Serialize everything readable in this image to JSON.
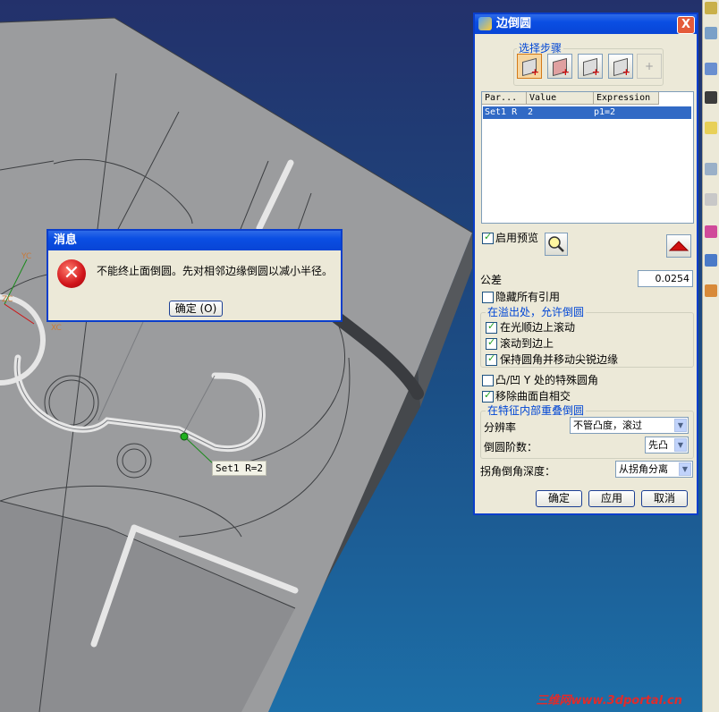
{
  "message_dialog": {
    "title": "消息",
    "text": "不能终止面倒圆。先对相邻边缘倒圆以减小半径。",
    "ok_label": "确定 (O)"
  },
  "viewport": {
    "edge_tag": "Set1 R=2",
    "axis_labels": [
      "YC",
      "ZC",
      "XC"
    ],
    "watermark": "三维网www.3dportal.cn"
  },
  "panel": {
    "title": "边倒圆",
    "close_label": "X",
    "steps_group": "选择步骤",
    "steps": [
      "edge-select-icon",
      "variable-radius-icon",
      "corner-setback-icon",
      "stop-short-icon",
      "add-point-icon"
    ],
    "table": {
      "headers": [
        "Par...",
        "Value",
        "Expression"
      ],
      "rows": [
        {
          "param": "Set1 R",
          "value": "2",
          "expression": "p1=2"
        }
      ]
    },
    "preview_label": "启用预览",
    "preview_checked": true,
    "tolerance_label": "公差",
    "tolerance_value": "0.0254",
    "hide_refs_label": "隐藏所有引用",
    "hide_refs_checked": false,
    "overflow_group": "在溢出处，允许倒圆",
    "overflow_options": [
      {
        "label": "在光顺边上滚动",
        "checked": true
      },
      {
        "label": "滚动到边上",
        "checked": true
      },
      {
        "label": "保持圆角并移动尖锐边缘",
        "checked": true
      }
    ],
    "special_y_label": "凸/凹 Y 处的特殊圆角",
    "special_y_checked": false,
    "remove_self_label": "移除曲面自相交",
    "remove_self_checked": true,
    "overlap_group": "在特征内部重叠倒圆",
    "resolution_label": "分辨率",
    "resolution_value": "不管凸度，滚过",
    "order_label": "倒圆阶数：",
    "order_value": "先凸",
    "corner_depth_label": "拐角倒角深度：",
    "corner_depth_value": "从拐角分离",
    "ok_label": "确定",
    "apply_label": "应用",
    "cancel_label": "取消"
  }
}
